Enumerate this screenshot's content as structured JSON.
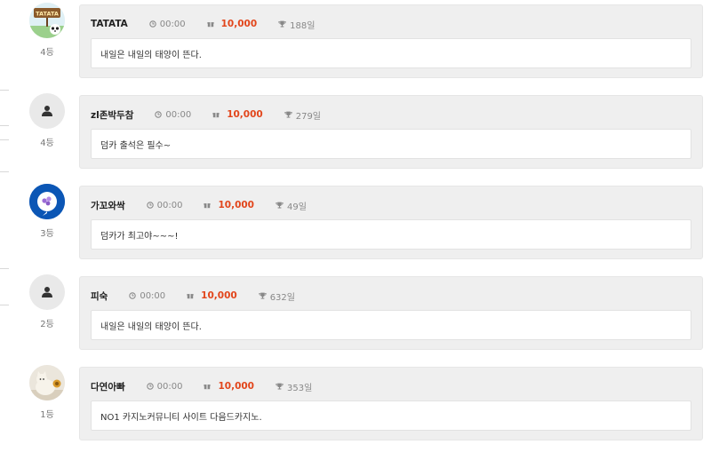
{
  "attendance_list": [
    {
      "nickname": "TATATA",
      "avatar": "tatata-avatar-image",
      "time": "00:00",
      "points": "10,000",
      "days": "188일",
      "rank": "4등",
      "message": "내일은 내일의 태양이 뜬다.",
      "avatar_text": "TATATA"
    },
    {
      "nickname": "zl존박두참",
      "avatar": "default-user-icon",
      "time": "00:00",
      "points": "10,000",
      "days": "279일",
      "rank": "4등",
      "message": "덤카 출석은 필수~"
    },
    {
      "nickname": "가꼬와싹",
      "avatar": "blue-avatar-image",
      "time": "00:00",
      "points": "10,000",
      "days": "49일",
      "rank": "3등",
      "message": "덤카가 최고야~~~!"
    },
    {
      "nickname": "피숙",
      "avatar": "default-user-icon",
      "time": "00:00",
      "points": "10,000",
      "days": "632일",
      "rank": "2등",
      "message": "내일은 내일의 태양이 뜬다."
    },
    {
      "nickname": "다연아빠",
      "avatar": "cat-avatar-image",
      "time": "00:00",
      "points": "10,000",
      "days": "353일",
      "rank": "1등",
      "message": "NO1 카지노커뮤니티 사이트 다음드카지노."
    }
  ],
  "colors": {
    "points_accent": "#e2461c",
    "card_bg": "#efefef",
    "message_bg": "#ffffff",
    "avatar_blue": "#0b56b5"
  },
  "icons": {
    "time": "clock-icon",
    "points": "gift-icon",
    "days": "trophy-icon"
  }
}
